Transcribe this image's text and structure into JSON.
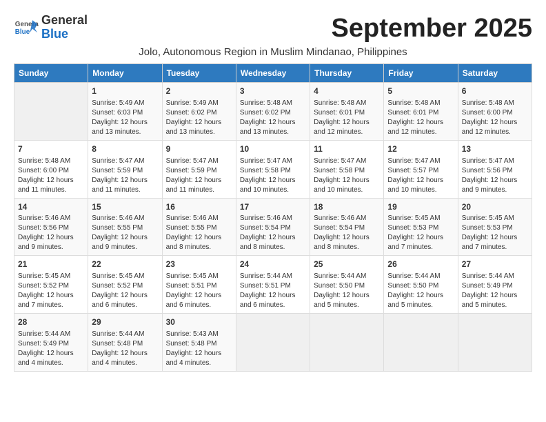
{
  "header": {
    "logo_line1": "General",
    "logo_line2": "Blue",
    "month_title": "September 2025",
    "subtitle": "Jolo, Autonomous Region in Muslim Mindanao, Philippines"
  },
  "days_of_week": [
    "Sunday",
    "Monday",
    "Tuesday",
    "Wednesday",
    "Thursday",
    "Friday",
    "Saturday"
  ],
  "weeks": [
    [
      {
        "day": "",
        "info": ""
      },
      {
        "day": "1",
        "info": "Sunrise: 5:49 AM\nSunset: 6:03 PM\nDaylight: 12 hours\nand 13 minutes."
      },
      {
        "day": "2",
        "info": "Sunrise: 5:49 AM\nSunset: 6:02 PM\nDaylight: 12 hours\nand 13 minutes."
      },
      {
        "day": "3",
        "info": "Sunrise: 5:48 AM\nSunset: 6:02 PM\nDaylight: 12 hours\nand 13 minutes."
      },
      {
        "day": "4",
        "info": "Sunrise: 5:48 AM\nSunset: 6:01 PM\nDaylight: 12 hours\nand 12 minutes."
      },
      {
        "day": "5",
        "info": "Sunrise: 5:48 AM\nSunset: 6:01 PM\nDaylight: 12 hours\nand 12 minutes."
      },
      {
        "day": "6",
        "info": "Sunrise: 5:48 AM\nSunset: 6:00 PM\nDaylight: 12 hours\nand 12 minutes."
      }
    ],
    [
      {
        "day": "7",
        "info": "Sunrise: 5:48 AM\nSunset: 6:00 PM\nDaylight: 12 hours\nand 11 minutes."
      },
      {
        "day": "8",
        "info": "Sunrise: 5:47 AM\nSunset: 5:59 PM\nDaylight: 12 hours\nand 11 minutes."
      },
      {
        "day": "9",
        "info": "Sunrise: 5:47 AM\nSunset: 5:59 PM\nDaylight: 12 hours\nand 11 minutes."
      },
      {
        "day": "10",
        "info": "Sunrise: 5:47 AM\nSunset: 5:58 PM\nDaylight: 12 hours\nand 10 minutes."
      },
      {
        "day": "11",
        "info": "Sunrise: 5:47 AM\nSunset: 5:58 PM\nDaylight: 12 hours\nand 10 minutes."
      },
      {
        "day": "12",
        "info": "Sunrise: 5:47 AM\nSunset: 5:57 PM\nDaylight: 12 hours\nand 10 minutes."
      },
      {
        "day": "13",
        "info": "Sunrise: 5:47 AM\nSunset: 5:56 PM\nDaylight: 12 hours\nand 9 minutes."
      }
    ],
    [
      {
        "day": "14",
        "info": "Sunrise: 5:46 AM\nSunset: 5:56 PM\nDaylight: 12 hours\nand 9 minutes."
      },
      {
        "day": "15",
        "info": "Sunrise: 5:46 AM\nSunset: 5:55 PM\nDaylight: 12 hours\nand 9 minutes."
      },
      {
        "day": "16",
        "info": "Sunrise: 5:46 AM\nSunset: 5:55 PM\nDaylight: 12 hours\nand 8 minutes."
      },
      {
        "day": "17",
        "info": "Sunrise: 5:46 AM\nSunset: 5:54 PM\nDaylight: 12 hours\nand 8 minutes."
      },
      {
        "day": "18",
        "info": "Sunrise: 5:46 AM\nSunset: 5:54 PM\nDaylight: 12 hours\nand 8 minutes."
      },
      {
        "day": "19",
        "info": "Sunrise: 5:45 AM\nSunset: 5:53 PM\nDaylight: 12 hours\nand 7 minutes."
      },
      {
        "day": "20",
        "info": "Sunrise: 5:45 AM\nSunset: 5:53 PM\nDaylight: 12 hours\nand 7 minutes."
      }
    ],
    [
      {
        "day": "21",
        "info": "Sunrise: 5:45 AM\nSunset: 5:52 PM\nDaylight: 12 hours\nand 7 minutes."
      },
      {
        "day": "22",
        "info": "Sunrise: 5:45 AM\nSunset: 5:52 PM\nDaylight: 12 hours\nand 6 minutes."
      },
      {
        "day": "23",
        "info": "Sunrise: 5:45 AM\nSunset: 5:51 PM\nDaylight: 12 hours\nand 6 minutes."
      },
      {
        "day": "24",
        "info": "Sunrise: 5:44 AM\nSunset: 5:51 PM\nDaylight: 12 hours\nand 6 minutes."
      },
      {
        "day": "25",
        "info": "Sunrise: 5:44 AM\nSunset: 5:50 PM\nDaylight: 12 hours\nand 5 minutes."
      },
      {
        "day": "26",
        "info": "Sunrise: 5:44 AM\nSunset: 5:50 PM\nDaylight: 12 hours\nand 5 minutes."
      },
      {
        "day": "27",
        "info": "Sunrise: 5:44 AM\nSunset: 5:49 PM\nDaylight: 12 hours\nand 5 minutes."
      }
    ],
    [
      {
        "day": "28",
        "info": "Sunrise: 5:44 AM\nSunset: 5:49 PM\nDaylight: 12 hours\nand 4 minutes."
      },
      {
        "day": "29",
        "info": "Sunrise: 5:44 AM\nSunset: 5:48 PM\nDaylight: 12 hours\nand 4 minutes."
      },
      {
        "day": "30",
        "info": "Sunrise: 5:43 AM\nSunset: 5:48 PM\nDaylight: 12 hours\nand 4 minutes."
      },
      {
        "day": "",
        "info": ""
      },
      {
        "day": "",
        "info": ""
      },
      {
        "day": "",
        "info": ""
      },
      {
        "day": "",
        "info": ""
      }
    ]
  ]
}
